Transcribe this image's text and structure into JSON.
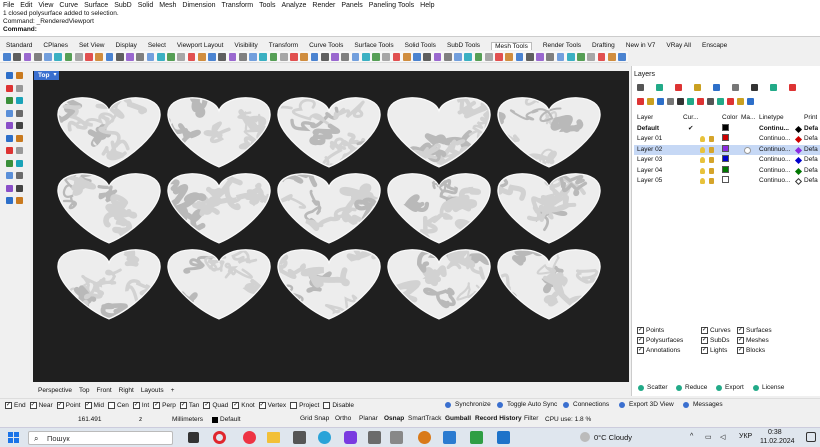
{
  "menu": [
    "File",
    "Edit",
    "View",
    "Curve",
    "Surface",
    "SubD",
    "Solid",
    "Mesh",
    "Dimension",
    "Transform",
    "Tools",
    "Analyze",
    "Render",
    "Panels",
    "Paneling Tools",
    "Help"
  ],
  "command_history": [
    "1 closed polysurface added to selection.",
    "Command: _RenderedViewport"
  ],
  "command_prompt": "Command:",
  "toolbar_tabs": [
    "Standard",
    "CPlanes",
    "Set View",
    "Display",
    "Select",
    "Viewport Layout",
    "Visibility",
    "Transform",
    "Curve Tools",
    "Surface Tools",
    "Solid Tools",
    "SubD Tools",
    "Mesh Tools",
    "Render Tools",
    "Drafting",
    "New in V7",
    "VRay All",
    "Enscape"
  ],
  "active_toolbar_tab": "Mesh Tools",
  "viewport": {
    "title": "Top",
    "background": "#1f1f1f",
    "rows": 3,
    "cols": 5
  },
  "viewport_tabs": [
    "Perspective",
    "Top",
    "Front",
    "Right",
    "Layouts",
    "+"
  ],
  "layers_panel": {
    "title": "Layers",
    "columns": [
      "Layer",
      "Cur...",
      "Color",
      "Ma...",
      "Linetype",
      "Print"
    ],
    "layers": [
      {
        "name": "Default",
        "current": "✔",
        "color": "#000000",
        "linetype": "Continu...",
        "print": "Defa",
        "selected": false
      },
      {
        "name": "Layer 01",
        "current": "",
        "color": "#cc0000",
        "linetype": "Continuo...",
        "print": "Defa",
        "selected": false
      },
      {
        "name": "Layer 02",
        "current": "",
        "color": "#8a2be2",
        "linetype": "Continuo...",
        "print": "Defa",
        "selected": true
      },
      {
        "name": "Layer 03",
        "current": "",
        "color": "#0000cc",
        "linetype": "Continuo...",
        "print": "Defa",
        "selected": false
      },
      {
        "name": "Layer 04",
        "current": "",
        "color": "#007700",
        "linetype": "Continuo...",
        "print": "Defa",
        "selected": false
      },
      {
        "name": "Layer 05",
        "current": "",
        "color": "#ffffff",
        "linetype": "Continuo...",
        "print": "Defa",
        "selected": false
      }
    ],
    "filters": [
      [
        "Points",
        "Curves",
        "Surfaces"
      ],
      [
        "Polysurfaces",
        "SubDs",
        "Meshes"
      ],
      [
        "Annotations",
        "Lights",
        "Blocks"
      ]
    ],
    "buttons": [
      "Scatter",
      "Reduce",
      "Export",
      "License"
    ]
  },
  "osnaps": [
    {
      "label": "End",
      "checked": true
    },
    {
      "label": "Near",
      "checked": true
    },
    {
      "label": "Point",
      "checked": true
    },
    {
      "label": "Mid",
      "checked": true
    },
    {
      "label": "Cen",
      "checked": false
    },
    {
      "label": "Int",
      "checked": true
    },
    {
      "label": "Perp",
      "checked": true
    },
    {
      "label": "Tan",
      "checked": true
    },
    {
      "label": "Quad",
      "checked": true
    },
    {
      "label": "Knot",
      "checked": true
    },
    {
      "label": "Vertex",
      "checked": true
    },
    {
      "label": "Project",
      "checked": false
    },
    {
      "label": "Disable",
      "checked": false
    }
  ],
  "plugin_bar": [
    "Synchronize",
    "Toggle Auto Sync",
    "Connections",
    "Export 3D View",
    "Messages"
  ],
  "status": {
    "coord": "161.491",
    "z": "z",
    "units": "Millimeters",
    "layer": "Default",
    "toggles": [
      "Grid Snap",
      "Ortho",
      "Planar",
      "Osnap",
      "SmartTrack",
      "Gumball",
      "Record History",
      "Filter"
    ],
    "cpu": "CPU use: 1.8 %"
  },
  "taskbar": {
    "search": "Пошук",
    "weather": "0°C  Cloudy",
    "lang": "УКР",
    "time": "0:38",
    "date": "11.02.2024"
  }
}
